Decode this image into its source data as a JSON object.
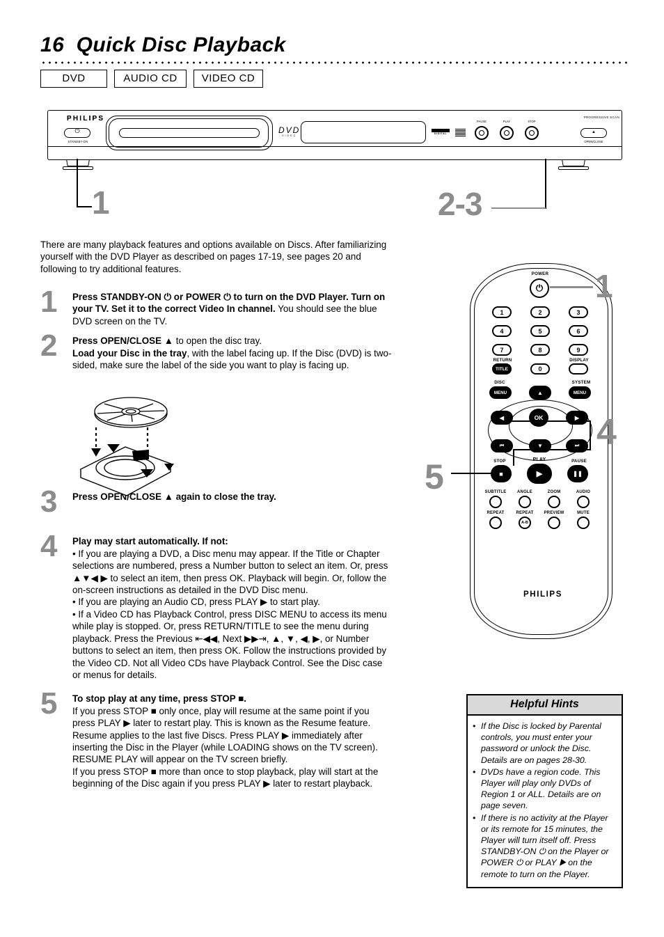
{
  "header": {
    "page_number": "16",
    "title": "16  Quick Disc Playback",
    "disc_tags": [
      "DVD",
      "AUDIO CD",
      "VIDEO CD"
    ]
  },
  "player": {
    "brand": "PHILIPS",
    "progressive_scan": "PROGRESSIVE SCAN",
    "standby_label": "STANDBY-ON",
    "open_close_label": "OPEN/CLOSE",
    "dvd_logo": "DVD",
    "dvd_logo_sub": "VIDEO",
    "dolby_text": "DIGITAL",
    "buttons": [
      {
        "label": "PAUSE",
        "glyph": "❚❚"
      },
      {
        "label": "PLAY",
        "glyph": "▶"
      },
      {
        "label": "STOP",
        "glyph": "■"
      }
    ],
    "callouts": [
      {
        "label": "1"
      },
      {
        "label": "2-3"
      }
    ]
  },
  "intro": "There are many playback features and options available on Discs. After familiarizing yourself with the DVD Player as described on pages 17-19, see pages 20 and following to try additional features.",
  "steps": [
    {
      "num": "1",
      "lines": [
        {
          "bold": "Press STANDBY-ON ⏻ or POWER ⏻ to turn on the DVD Player.  Turn on your TV.  Set it to the correct Video In channel.",
          "rest": " You should see the blue DVD screen on the TV."
        }
      ]
    },
    {
      "num": "2",
      "lines": [
        {
          "bold": "Press OPEN/CLOSE ▲",
          "rest": " to open the disc tray."
        },
        {
          "bold": "Load your Disc in the tray",
          "rest": ", with the label facing up. If the Disc (DVD) is two-sided, make sure the label of the side you want to play is facing up."
        }
      ]
    },
    {
      "num": "3",
      "lines": [
        {
          "bold": "Press OPEN/CLOSE ▲ again to close the tray.",
          "rest": ""
        }
      ]
    },
    {
      "num": "4",
      "lines": [
        {
          "bold": "Play may start automatically. If not:",
          "rest": ""
        },
        {
          "bold": "",
          "rest": "• If you are playing a DVD, a Disc menu may appear. If the Title or Chapter selections are numbered, press a Number button to select an item. Or, press ▲▼◀ ▶ to select an item, then press OK. Playback will begin. Or, follow the on-screen instructions as detailed in the DVD Disc menu."
        },
        {
          "bold": "",
          "rest": "• If you are playing an Audio CD, press PLAY ▶ to start play."
        },
        {
          "bold": "",
          "rest": "• If a Video CD has Playback Control, press DISC MENU to access its menu while play is stopped. Or, press RETURN/TITLE to see the menu during playback.  Press the Previous ⇤◀◀, Next ▶▶⇥, ▲, ▼, ◀, ▶, or Number buttons to select an item, then press OK. Follow the instructions provided by the Video CD. Not all Video CDs have Playback Control. See the Disc case or menus for details."
        }
      ]
    },
    {
      "num": "5",
      "lines": [
        {
          "bold": "To stop play at any time, press STOP ■.",
          "rest": ""
        },
        {
          "bold": "",
          "rest": "If you press STOP ■ only once, play will resume at the same point if you press PLAY ▶ later to restart play. This is known as the Resume feature."
        },
        {
          "bold": "",
          "rest": "Resume applies to the last five Discs. Press PLAY ▶ immediately after inserting the Disc in the Player (while LOADING shows on the TV screen). RESUME PLAY will appear on the TV screen briefly."
        },
        {
          "bold": "",
          "rest": "If you press STOP ■ more than once to stop playback, play will start at the beginning of the Disc again if you press PLAY ▶ later to restart playback."
        }
      ]
    }
  ],
  "remote": {
    "brand": "PHILIPS",
    "power_label": "POWER",
    "power_glyph": "⏻",
    "numbers": [
      "1",
      "2",
      "3",
      "4",
      "5",
      "6",
      "7",
      "8",
      "9",
      "0"
    ],
    "return_label": "RETURN",
    "title_key": "TITLE",
    "display_label": "DISPLAY",
    "disc_label": "DISC",
    "system_label": "SYSTEM",
    "menu_key": "MENU",
    "ok_key": "OK",
    "transport": [
      {
        "label": "STOP",
        "glyph": "■"
      },
      {
        "label": "PLAY",
        "glyph": "▶"
      },
      {
        "label": "PAUSE",
        "glyph": "❚❚"
      }
    ],
    "feature_row_1": [
      "SUBTITLE",
      "ANGLE",
      "ZOOM",
      "AUDIO"
    ],
    "feature_row_2": [
      "REPEAT",
      "REPEAT",
      "PREVIEW",
      "MUTE"
    ],
    "repeat_ab_key": "A-B",
    "callouts": [
      {
        "label": "1"
      },
      {
        "label": "4"
      },
      {
        "label": "5"
      }
    ]
  },
  "hints": {
    "title": "Helpful Hints",
    "items": [
      "If the Disc is locked by Parental controls, you must enter your password or unlock the Disc. Details are on pages 28-30.",
      "DVDs have a region code. This Player will play only DVDs of Region 1 or ALL. Details are on page seven.",
      "If there is no activity at the Player or its remote for 15 minutes, the Player will turn itself off. Press STANDBY-ON ⏻ on the Player or POWER ⏻ or PLAY ▶ on the remote to turn on the Player."
    ]
  },
  "colors": {
    "callout_gray": "#8c8c8c",
    "hint_header": "#d9d9d9",
    "ink": "#000000"
  }
}
